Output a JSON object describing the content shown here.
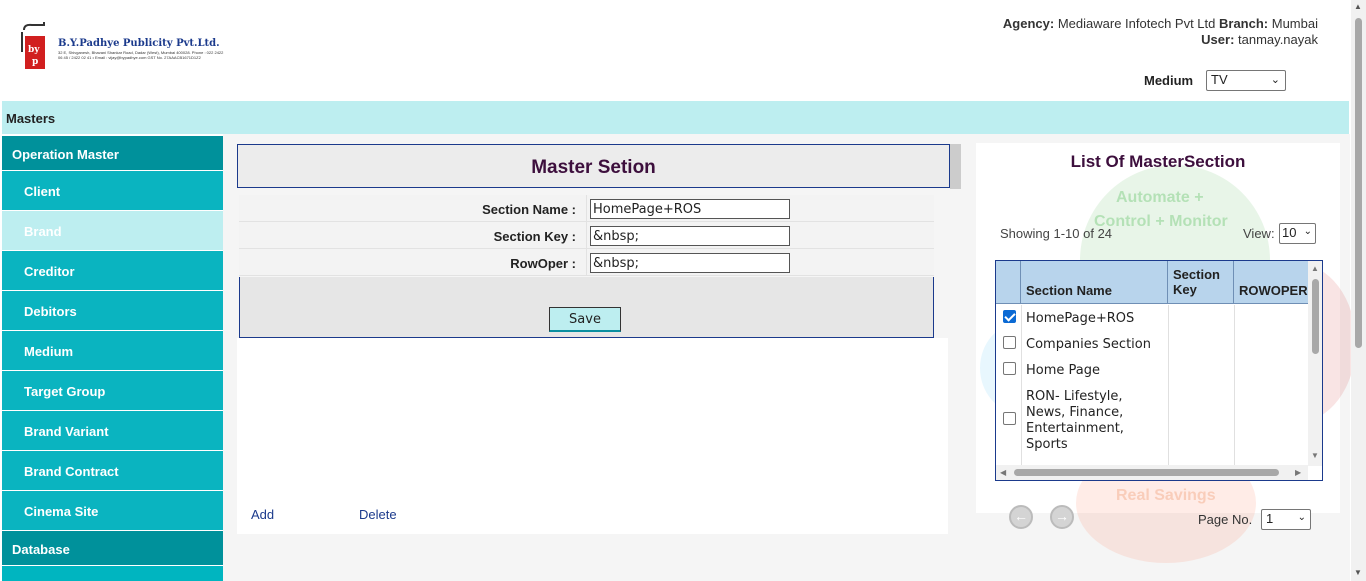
{
  "header": {
    "logo_name": "B.Y.Padhye Publicity Pvt.Ltd.",
    "logo_address": "32 E, Shivganesh, Bhavani Shankar Road, Dadar (West), Mumbai 400028. Phone : 022 2422 06 45 / 2422 02 41 • Email : vijay@bypadhye.com GST No. 27AAACB1671D1Z2",
    "agency_label": "Agency:",
    "agency_value": "Mediaware Infotech Pvt Ltd",
    "branch_label": "Branch:",
    "branch_value": "Mumbai",
    "user_label": "User:",
    "user_value": "tanmay.nayak",
    "medium_label": "Medium",
    "medium_value": "TV"
  },
  "masters_bar": "Masters",
  "sidebar": {
    "header": "Operation Master",
    "items": [
      "Client",
      "Brand",
      "Creditor",
      "Debitors",
      "Medium",
      "Target Group",
      "Brand Variant",
      "Brand Contract",
      "Cinema Site"
    ],
    "active_index": 1,
    "footer_header": "Database"
  },
  "form": {
    "title": "Master Setion",
    "fields": [
      {
        "label": "Section Name :",
        "value": "HomePage+ROS"
      },
      {
        "label": "Section Key :",
        "value": "&nbsp;"
      },
      {
        "label": "RowOper :",
        "value": "&nbsp;"
      }
    ],
    "save_label": "Save",
    "add_label": "Add",
    "delete_label": "Delete"
  },
  "list": {
    "title": "List Of MasterSection",
    "showing": "Showing 1-10 of 24",
    "view_label": "View:",
    "view_value": "10",
    "columns": [
      "Section Name",
      "Section Key",
      "ROWOPER"
    ],
    "rows": [
      {
        "name": "HomePage+ROS",
        "checked": true
      },
      {
        "name": "Companies Section",
        "checked": false
      },
      {
        "name": "Home Page",
        "checked": false
      },
      {
        "name": "RON- Lifestyle, News, Finance, Entertainment, Sports",
        "checked": false
      }
    ],
    "watermark": [
      "Automate +",
      "Control + Monitor",
      "Real Savings"
    ],
    "page_label": "Page No.",
    "page_value": "1",
    "prev_icon": "prev-arrow-icon",
    "next_icon": "next-arrow-icon"
  }
}
